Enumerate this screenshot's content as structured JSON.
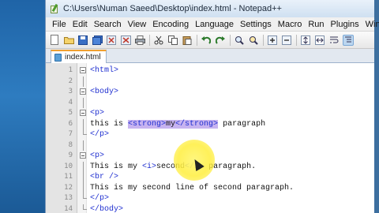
{
  "window": {
    "title": "C:\\Users\\Numan Saeed\\Desktop\\index.html - Notepad++"
  },
  "menu": [
    "File",
    "Edit",
    "Search",
    "View",
    "Encoding",
    "Language",
    "Settings",
    "Macro",
    "Run",
    "Plugins",
    "Window"
  ],
  "toolbar": {
    "icons": [
      "new-file-icon",
      "open-file-icon",
      "save-icon",
      "save-all-icon",
      "close-icon",
      "close-all-icon",
      "print-icon",
      "cut-icon",
      "copy-icon",
      "paste-icon",
      "undo-icon",
      "redo-icon",
      "find-icon",
      "replace-icon",
      "zoom-in-icon",
      "zoom-out-icon",
      "sync-v-icon",
      "sync-h-icon",
      "wrap-icon",
      "indent-guide-icon"
    ]
  },
  "tab": {
    "label": "index.html"
  },
  "editor": {
    "lines": [
      {
        "n": "1",
        "fold": "box",
        "text": "<html>"
      },
      {
        "n": "2",
        "fold": "line",
        "text": ""
      },
      {
        "n": "3",
        "fold": "box",
        "text": "<body>"
      },
      {
        "n": "4",
        "fold": "line",
        "text": ""
      },
      {
        "n": "5",
        "fold": "box",
        "text": "<p>"
      },
      {
        "n": "6",
        "fold": "line",
        "text": "this is <strong>my</strong> paragraph"
      },
      {
        "n": "7",
        "fold": "end",
        "text": "</p>"
      },
      {
        "n": "8",
        "fold": "line",
        "text": ""
      },
      {
        "n": "9",
        "fold": "box",
        "text": "<p>"
      },
      {
        "n": "10",
        "fold": "line",
        "text": "This is my <i>second</i> paragraph."
      },
      {
        "n": "11",
        "fold": "line",
        "text": "<br />"
      },
      {
        "n": "12",
        "fold": "line",
        "text": "This is my second line of second paragraph."
      },
      {
        "n": "13",
        "fold": "end",
        "text": "</p>"
      },
      {
        "n": "14",
        "fold": "end",
        "text": "</body>"
      }
    ]
  },
  "colors": {
    "tag": "#1f2fd0",
    "highlight": "#c7b3f0",
    "cursor_highlight": "#ffee3c"
  }
}
